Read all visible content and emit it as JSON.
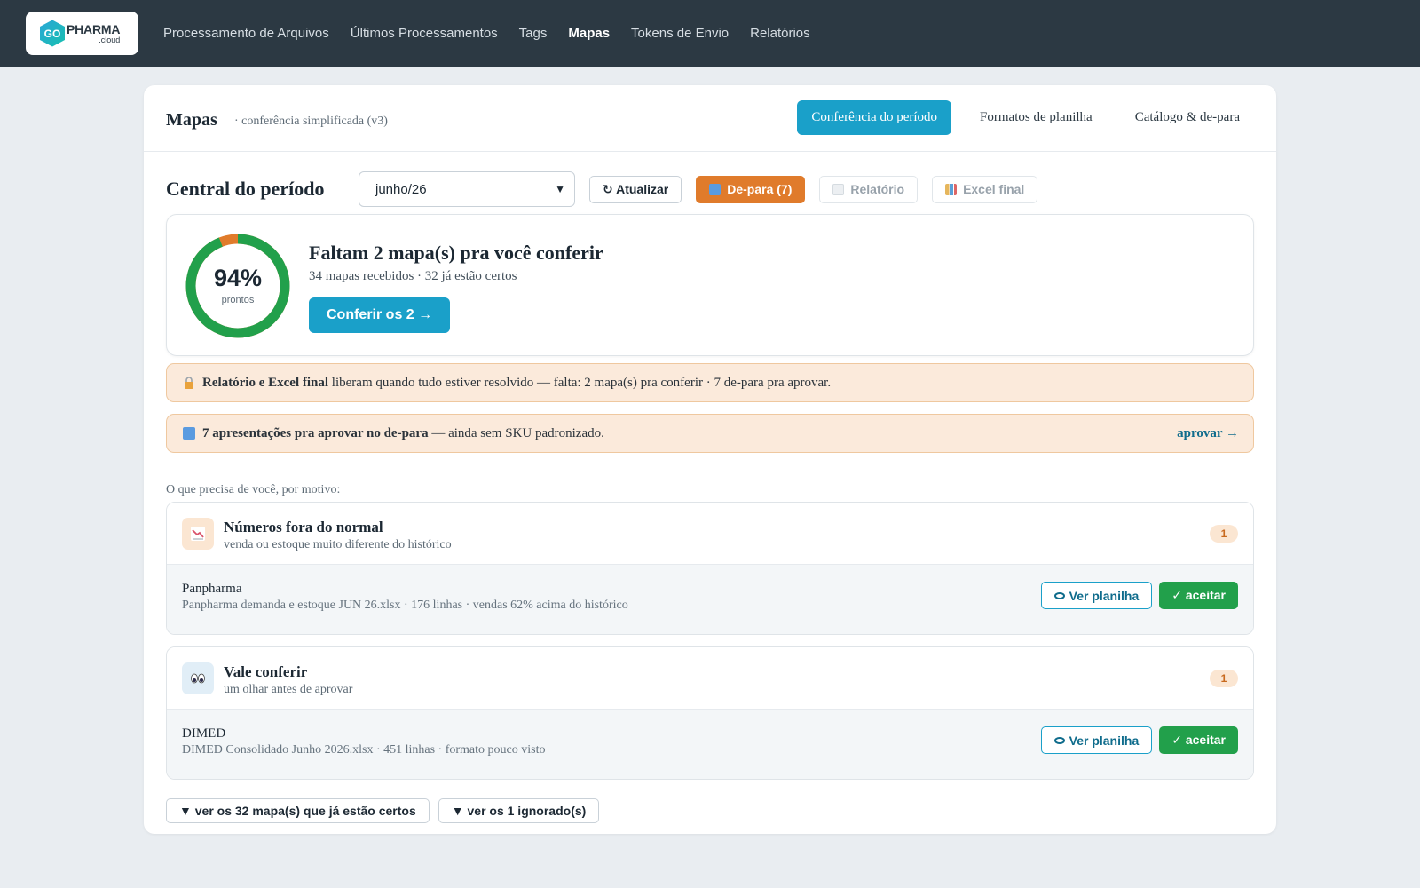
{
  "app": {
    "logo_badge": "GO",
    "logo_word": "PHARMA",
    "logo_sub": ".cloud"
  },
  "nav": {
    "items": [
      {
        "label": "Processamento de Arquivos",
        "active": false
      },
      {
        "label": "Últimos Processamentos",
        "active": false
      },
      {
        "label": "Tags",
        "active": false
      },
      {
        "label": "Mapas",
        "active": true
      },
      {
        "label": "Tokens de Envio",
        "active": false
      },
      {
        "label": "Relatórios",
        "active": false
      }
    ]
  },
  "header": {
    "title": "Mapas",
    "subtitle": "· conferência simplificada (v3)",
    "tabs": [
      {
        "label": "Conferência do período",
        "active": true
      },
      {
        "label": "Formatos de planilha",
        "active": false
      },
      {
        "label": "Catálogo & de-para",
        "active": false
      }
    ]
  },
  "toolbar": {
    "title": "Central do período",
    "period_value": "junho/26",
    "refresh_label": "↻ Atualizar",
    "depara_label": "De-para (7)",
    "report_label": "Relatório",
    "excel_label": "Excel final"
  },
  "summary": {
    "percent": 94,
    "percent_label": "94%",
    "percent_sub": "prontos",
    "title": "Faltam 2 mapa(s) pra você conferir",
    "subtitle": "34 mapas recebidos · 32 já estão certos",
    "cta_label": "Conferir os 2 →",
    "colors": {
      "done": "#22a04b",
      "pending": "#e07b2b"
    }
  },
  "alerts": {
    "lock": {
      "bold": "Relatório e Excel final",
      "text": " liberam quando tudo estiver resolvido — falta: 2 mapa(s) pra conferir · 7 de-para pra aprovar."
    },
    "depara": {
      "bold": "7 apresentações pra aprovar no de-para",
      "text": " — ainda sem SKU padronizado.",
      "link": "aprovar →"
    }
  },
  "reasons_label": "O que precisa de você, por motivo:",
  "groups": [
    {
      "icon": "chart-down-icon",
      "title": "Números fora do normal",
      "subtitle": "venda ou estoque muito diferente do histórico",
      "count": "1",
      "row": {
        "name": "Panpharma",
        "meta": "Panpharma demanda e estoque JUN 26.xlsx · 176 linhas · vendas 62% acima do histórico",
        "view_label": "Ver planilha",
        "accept_label": "✓ aceitar"
      }
    },
    {
      "icon": "eyes-icon",
      "title": "Vale conferir",
      "subtitle": "um olhar antes de aprovar",
      "count": "1",
      "row": {
        "name": "DIMED",
        "meta": "DIMED Consolidado Junho 2026.xlsx · 451 linhas · formato pouco visto",
        "view_label": "Ver planilha",
        "accept_label": "✓ aceitar"
      }
    }
  ],
  "footer": {
    "correct_toggle": "▼ ver os 32 mapa(s) que já estão certos",
    "ignored_toggle": "▼ ver os 1 ignorado(s)"
  }
}
